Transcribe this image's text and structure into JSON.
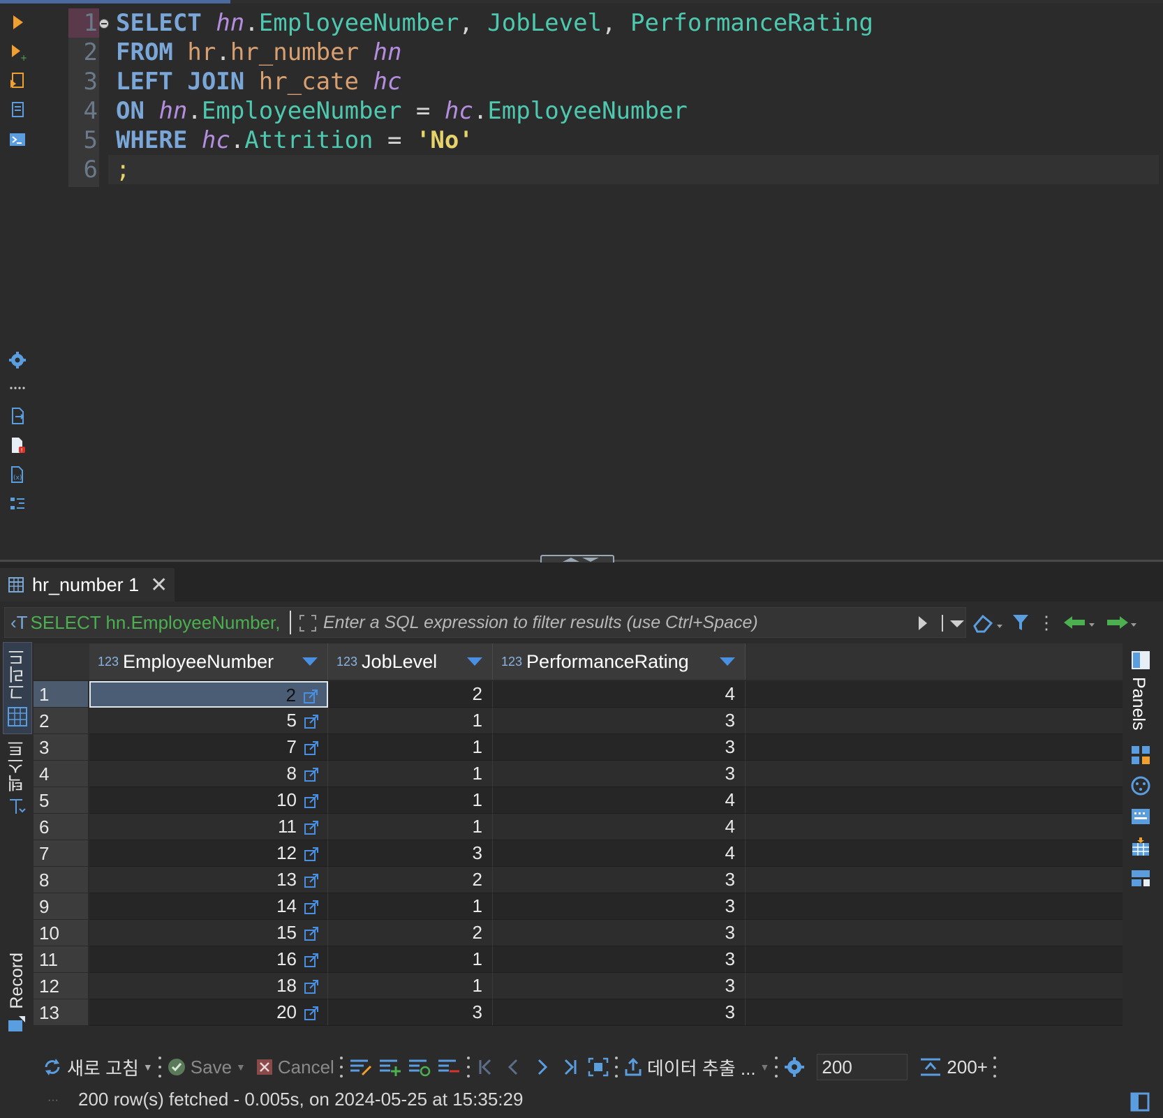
{
  "editor": {
    "line_numbers": [
      "1",
      "2",
      "3",
      "4",
      "5",
      "6"
    ],
    "lines": [
      [
        {
          "t": "SELECT",
          "c": "kw"
        },
        {
          "t": " ",
          "c": "punc"
        },
        {
          "t": "hn",
          "c": "alias"
        },
        {
          "t": ".",
          "c": "punc"
        },
        {
          "t": "EmployeeNumber",
          "c": "col"
        },
        {
          "t": ", ",
          "c": "punc"
        },
        {
          "t": "JobLevel",
          "c": "col"
        },
        {
          "t": ", ",
          "c": "punc"
        },
        {
          "t": "PerformanceRating",
          "c": "col"
        }
      ],
      [
        {
          "t": "FROM",
          "c": "kw"
        },
        {
          "t": " ",
          "c": "punc"
        },
        {
          "t": "hr",
          "c": "tbl"
        },
        {
          "t": ".",
          "c": "punc"
        },
        {
          "t": "hr_number",
          "c": "tbl"
        },
        {
          "t": " ",
          "c": "punc"
        },
        {
          "t": "hn",
          "c": "alias"
        }
      ],
      [
        {
          "t": "LEFT JOIN",
          "c": "kw"
        },
        {
          "t": " ",
          "c": "punc"
        },
        {
          "t": "hr_cate",
          "c": "tbl"
        },
        {
          "t": " ",
          "c": "punc"
        },
        {
          "t": "hc",
          "c": "alias"
        }
      ],
      [
        {
          "t": "ON",
          "c": "kw"
        },
        {
          "t": " ",
          "c": "punc"
        },
        {
          "t": "hn",
          "c": "alias"
        },
        {
          "t": ".",
          "c": "punc"
        },
        {
          "t": "EmployeeNumber",
          "c": "col"
        },
        {
          "t": " = ",
          "c": "punc"
        },
        {
          "t": "hc",
          "c": "alias"
        },
        {
          "t": ".",
          "c": "punc"
        },
        {
          "t": "EmployeeNumber",
          "c": "col"
        }
      ],
      [
        {
          "t": "WHERE",
          "c": "kw"
        },
        {
          "t": " ",
          "c": "punc"
        },
        {
          "t": "hc",
          "c": "alias"
        },
        {
          "t": ".",
          "c": "punc"
        },
        {
          "t": "Attrition",
          "c": "col"
        },
        {
          "t": " = ",
          "c": "punc"
        },
        {
          "t": "'No'",
          "c": "str"
        }
      ],
      [
        {
          "t": ";",
          "c": "semi"
        }
      ]
    ]
  },
  "results": {
    "tab_label": "hr_number 1",
    "filter_prefix": "SELECT hn.EmployeeNumber,",
    "filter_placeholder": "Enter a SQL expression to filter results (use Ctrl+Space)",
    "side_tabs": {
      "grid": "그리드",
      "text": "텍스트",
      "record": "Record"
    },
    "panels_label": "Panels",
    "columns": [
      {
        "type": "123",
        "name": "EmployeeNumber"
      },
      {
        "type": "123",
        "name": "JobLevel"
      },
      {
        "type": "123",
        "name": "PerformanceRating"
      }
    ],
    "rows": [
      {
        "n": "1",
        "cells": [
          "2",
          "2",
          "4"
        ]
      },
      {
        "n": "2",
        "cells": [
          "5",
          "1",
          "3"
        ]
      },
      {
        "n": "3",
        "cells": [
          "7",
          "1",
          "3"
        ]
      },
      {
        "n": "4",
        "cells": [
          "8",
          "1",
          "3"
        ]
      },
      {
        "n": "5",
        "cells": [
          "10",
          "1",
          "4"
        ]
      },
      {
        "n": "6",
        "cells": [
          "11",
          "1",
          "4"
        ]
      },
      {
        "n": "7",
        "cells": [
          "12",
          "3",
          "4"
        ]
      },
      {
        "n": "8",
        "cells": [
          "13",
          "2",
          "3"
        ]
      },
      {
        "n": "9",
        "cells": [
          "14",
          "1",
          "3"
        ]
      },
      {
        "n": "10",
        "cells": [
          "15",
          "2",
          "3"
        ]
      },
      {
        "n": "11",
        "cells": [
          "16",
          "1",
          "3"
        ]
      },
      {
        "n": "12",
        "cells": [
          "18",
          "1",
          "3"
        ]
      },
      {
        "n": "13",
        "cells": [
          "20",
          "3",
          "3"
        ]
      }
    ]
  },
  "toolbar": {
    "refresh_label": "새로 고침",
    "save_label": "Save",
    "cancel_label": "Cancel",
    "export_label": "데이터 추출 ...",
    "fetch_size": "200",
    "fetch_all_label": "200+"
  },
  "status": {
    "message": "200 row(s) fetched - 0.005s, on 2024-05-25 at 15:35:29"
  },
  "colors": {
    "keyword": "#7ba7d8",
    "alias": "#b58ee0",
    "column": "#4ec9b0",
    "table": "#d8a070",
    "string": "#e6d36a",
    "accent": "#4a90e2"
  }
}
